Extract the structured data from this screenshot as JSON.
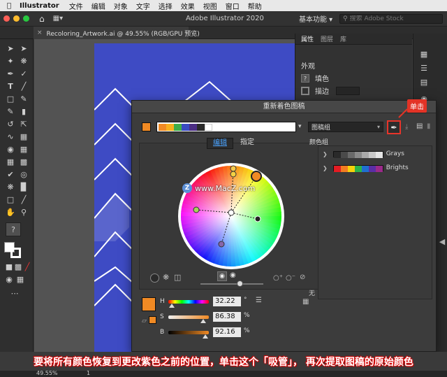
{
  "mac_menu": {
    "app_name": "Illustrator",
    "items": [
      "文件",
      "编辑",
      "对象",
      "文字",
      "选择",
      "效果",
      "视图",
      "窗口",
      "帮助"
    ]
  },
  "app_bar": {
    "title": "Adobe Illustrator 2020",
    "workspace": "基本功能",
    "search_placeholder": "搜索 Adobe Stock"
  },
  "document_tab": {
    "label": "Recoloring_Artwork.ai @ 49.55% (RGB/GPU 预览)"
  },
  "right_panel": {
    "tabs": [
      "属性",
      "图层",
      "库"
    ],
    "section_appearance": "外观",
    "fill_label": "填色",
    "stroke_label": "描边"
  },
  "dialog": {
    "title": "重新着色图稿",
    "colors_source": "图稿组",
    "tabs": [
      "编辑",
      "指定"
    ],
    "color_groups_label": "颜色组",
    "groups": [
      {
        "name": "Grays",
        "colors": [
          "#2a2a2a",
          "#4a4a4a",
          "#6a6a6a",
          "#8a8a8a",
          "#aaaaaa",
          "#c8c8c8",
          "#e6e6e6"
        ]
      },
      {
        "name": "Brights",
        "colors": [
          "#e41c23",
          "#f27c21",
          "#f6d10b",
          "#2db24a",
          "#1f6fd0",
          "#5a2ea6",
          "#9b2a8a"
        ]
      }
    ],
    "harmony_colors": [
      "#f18a1c",
      "#f6a531",
      "#d9534f",
      "#5cb85c",
      "#2a2a2a",
      "#4b2e84",
      "#ffffff"
    ],
    "hsb": {
      "h_label": "H",
      "h_value": "32.22",
      "h_unit": "°",
      "s_label": "S",
      "s_value": "86.38",
      "s_unit": "%",
      "b_label": "B",
      "b_value": "92.16",
      "b_unit": "%",
      "h_level": 0.09,
      "s_level": 0.8638,
      "b_level": 0.9216
    },
    "none_label": "无",
    "selected_color": "#f08a24"
  },
  "callout": {
    "label": "单击"
  },
  "watermark": {
    "text": "www.MacZ.com"
  },
  "caption": {
    "text": "要将所有颜色恢复到更改紫色之前的位置，单击这个「吸管」， 再次提取图稿的原始颜色"
  },
  "status": {
    "zoom": "49.55%",
    "artboard_num": "1"
  }
}
